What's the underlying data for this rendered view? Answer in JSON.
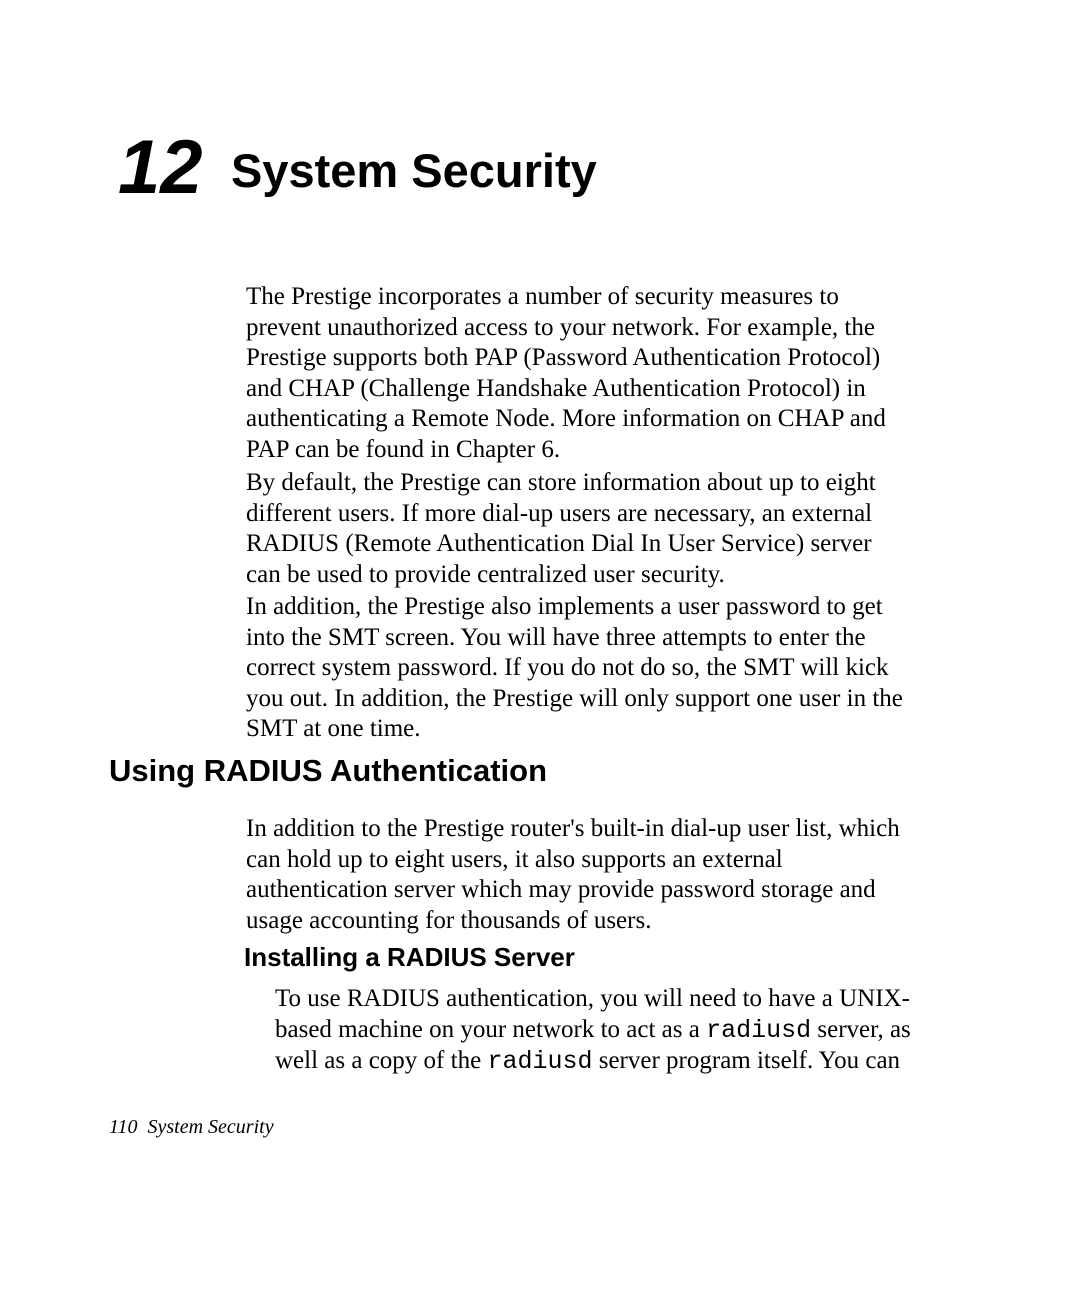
{
  "chapter": {
    "number": "12",
    "title": "System Security"
  },
  "paragraphs": {
    "p1": "The Prestige incorporates a number of security measures to prevent unauthorized access to your network. For example, the Prestige supports both PAP (Password Authentication Protocol) and CHAP (Challenge Handshake Authentication Protocol) in authenticating a Remote Node. More information on CHAP and PAP can be found in Chapter 6.",
    "p2": "By default, the Prestige can store information about up to eight different users. If more dial-up users are necessary, an external RADIUS (Remote Authentication Dial In User Service) server can be used to provide centralized user security.",
    "p3": "In addition, the Prestige also implements a user password to get into the SMT screen. You will have three attempts to enter the correct system password. If you do not do so, the SMT will kick you out. In addition, the Prestige will only support one user in the SMT at one time.",
    "p4": "In addition to the Prestige router's built-in dial-up user list, which can hold up to eight users, it also supports an external authentication server which may provide password storage and usage accounting for thousands of users.",
    "p5_a": "To use RADIUS authentication, you will need to have a UNIX-based machine on your network to act as a ",
    "p5_m1": "radiusd",
    "p5_b": " server, as well as a copy of the ",
    "p5_m2": "radiusd",
    "p5_c": " server program itself. You can"
  },
  "headings": {
    "h2": "Using RADIUS Authentication",
    "h3": "Installing a RADIUS Server"
  },
  "footer": {
    "page_number": "110",
    "running_title": "System Security"
  }
}
